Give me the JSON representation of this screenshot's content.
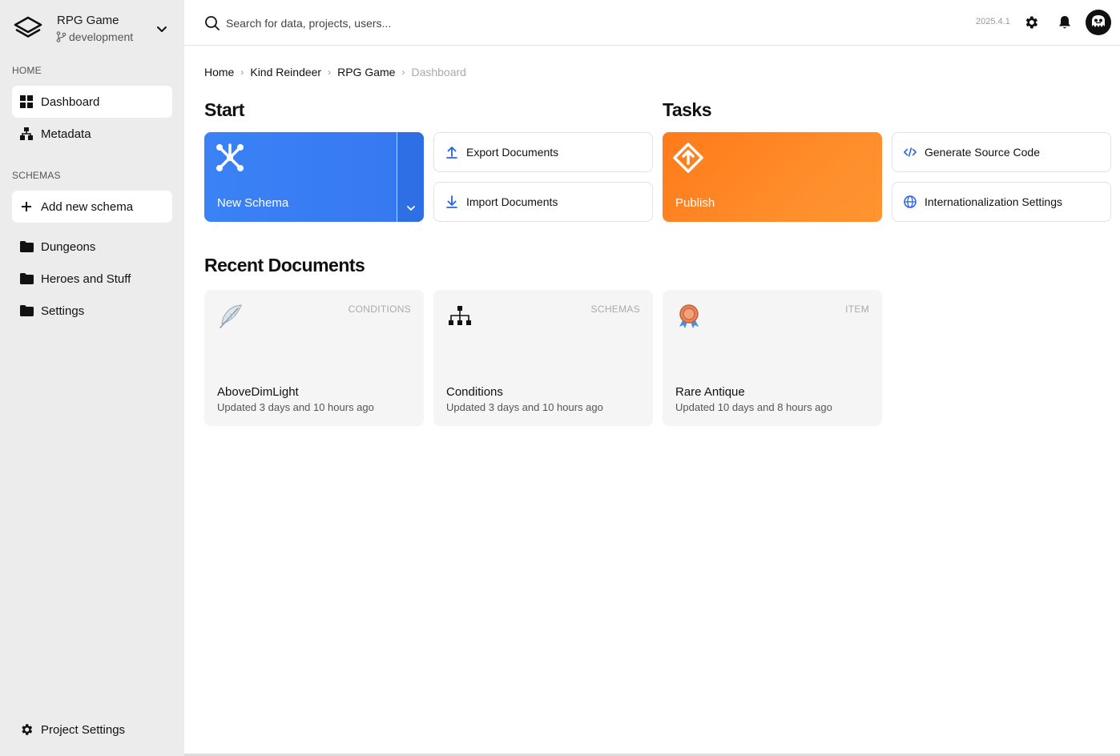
{
  "project": {
    "name": "RPG Game",
    "branch": "development"
  },
  "sidebar": {
    "home_label": "HOME",
    "home_items": [
      {
        "label": "Dashboard",
        "icon": "dashboard-icon",
        "active": true
      },
      {
        "label": "Metadata",
        "icon": "hierarchy-icon",
        "active": false
      }
    ],
    "schemas_label": "SCHEMAS",
    "add_schema_label": "Add new schema",
    "folders": [
      {
        "label": "Dungeons",
        "icon": "folder-icon"
      },
      {
        "label": "Heroes and Stuff",
        "icon": "folder-icon"
      },
      {
        "label": "Settings",
        "icon": "folder-icon"
      }
    ],
    "project_settings_label": "Project Settings"
  },
  "topbar": {
    "search_placeholder": "Search for data, projects, users...",
    "version": "2025.4.1"
  },
  "breadcrumb": [
    "Home",
    "Kind Reindeer",
    "RPG Game",
    "Dashboard"
  ],
  "start": {
    "title": "Start",
    "new_schema_label": "New Schema",
    "export_label": "Export Documents",
    "import_label": "Import Documents"
  },
  "tasks": {
    "title": "Tasks",
    "publish_label": "Publish",
    "generate_label": "Generate Source Code",
    "i18n_label": "Internationalization Settings"
  },
  "recent": {
    "title": "Recent Documents",
    "documents": [
      {
        "title": "AboveDimLight",
        "updated": "Updated 3 days and 10 hours ago",
        "tag": "CONDITIONS",
        "icon": "feather-icon"
      },
      {
        "title": "Conditions",
        "updated": "Updated 3 days and 10 hours ago",
        "tag": "SCHEMAS",
        "icon": "org-chart-icon"
      },
      {
        "title": "Rare Antique",
        "updated": "Updated 10 days and 8 hours ago",
        "tag": "ITEM",
        "icon": "medal-icon"
      }
    ]
  },
  "colors": {
    "primary_blue": "#3b82f6",
    "accent_orange": "#ff7a1a",
    "sidebar_bg": "#ececec"
  }
}
